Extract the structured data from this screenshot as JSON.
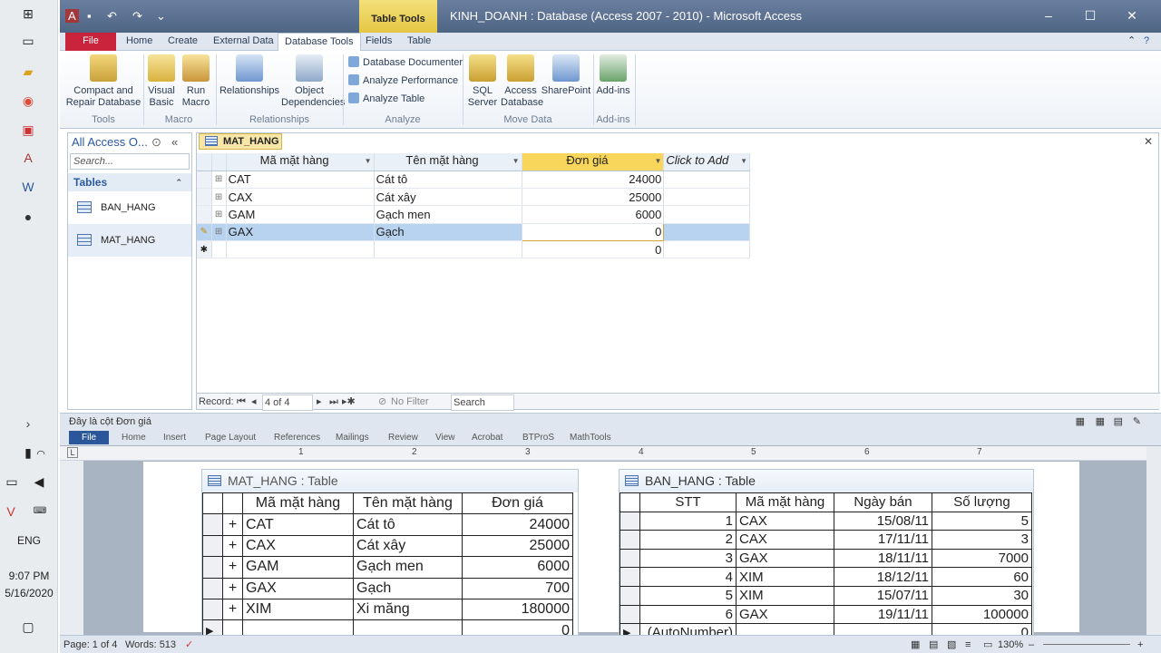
{
  "taskbar": {
    "language": "ENG",
    "time": "9:07 PM",
    "date": "5/16/2020"
  },
  "access": {
    "window_title": "KINH_DOANH : Database (Access 2007 - 2010)  -  Microsoft Access",
    "context_tab": "Table Tools",
    "ribbon_tabs": [
      {
        "label": "File"
      },
      {
        "label": "Home"
      },
      {
        "label": "Create"
      },
      {
        "label": "External Data"
      },
      {
        "label": "Database Tools"
      },
      {
        "label": "Fields"
      },
      {
        "label": "Table"
      }
    ],
    "ribbon": {
      "compact_repair": "Compact and Repair Database",
      "visual_basic": "Visual Basic",
      "run_macro": "Run Macro",
      "relationships": "Relationships",
      "object_dependencies": "Object Dependencies",
      "database_documenter": "Database Documenter",
      "analyze_performance": "Analyze Performance",
      "analyze_table": "Analyze Table",
      "sql_server": "SQL Server",
      "access_database": "Access Database",
      "sharepoint": "SharePoint",
      "add_ins": "Add-ins",
      "groups": {
        "tools": "Tools",
        "macro": "Macro",
        "relationships": "Relationships",
        "analyze": "Analyze",
        "move_data": "Move Data",
        "add_ins": "Add-ins"
      }
    },
    "nav_pane": {
      "header": "All Access O...",
      "search_placeholder": "Search...",
      "section": "Tables",
      "items": [
        "BAN_HANG",
        "MAT_HANG"
      ]
    },
    "datasheet": {
      "tab": "MAT_HANG",
      "columns": [
        "Mã mặt hàng",
        "Tên mặt hàng",
        "Đơn giá",
        "Click to Add"
      ],
      "rows": [
        {
          "ma": "CAT",
          "ten": "Cát tô",
          "gia": "24000"
        },
        {
          "ma": "CAX",
          "ten": "Cát xây",
          "gia": "25000"
        },
        {
          "ma": "GAM",
          "ten": "Gạch men",
          "gia": "6000"
        },
        {
          "ma": "GAX",
          "ten": "Gạch",
          "gia": "0"
        }
      ],
      "new_row_default": "0",
      "record_label": "Record:",
      "record_position": "4 of 4",
      "no_filter": "No Filter",
      "search": "Search"
    },
    "status": "Đây là cột Đơn giá"
  },
  "word": {
    "tabs": [
      "File",
      "Home",
      "Insert",
      "Page Layout",
      "References",
      "Mailings",
      "Review",
      "View",
      "Acrobat",
      "BTProS",
      "MathTools"
    ],
    "ruler_ticks": [
      "1",
      "2",
      "3",
      "4",
      "5",
      "6",
      "7"
    ],
    "mat_hang_snapshot": {
      "title": "MAT_HANG : Table",
      "columns": [
        "Mã mặt hàng",
        "Tên mặt hàng",
        "Đơn giá"
      ],
      "rows": [
        {
          "ma": "CAT",
          "ten": "Cát tô",
          "gia": "24000"
        },
        {
          "ma": "CAX",
          "ten": "Cát xây",
          "gia": "25000"
        },
        {
          "ma": "GAM",
          "ten": "Gạch men",
          "gia": "6000"
        },
        {
          "ma": "GAX",
          "ten": "Gạch",
          "gia": "700"
        },
        {
          "ma": "XIM",
          "ten": "Xi măng",
          "gia": "180000"
        }
      ],
      "new_row_default": "0"
    },
    "ban_hang_snapshot": {
      "title": "BAN_HANG : Table",
      "columns": [
        "STT",
        "Mã mặt hàng",
        "Ngày bán",
        "Số lượng"
      ],
      "rows": [
        {
          "stt": "1",
          "ma": "CAX",
          "ngay": "15/08/11",
          "sl": "5"
        },
        {
          "stt": "2",
          "ma": "CAX",
          "ngay": "17/11/11",
          "sl": "3"
        },
        {
          "stt": "3",
          "ma": "GAX",
          "ngay": "18/11/11",
          "sl": "7000"
        },
        {
          "stt": "4",
          "ma": "XIM",
          "ngay": "18/12/11",
          "sl": "60"
        },
        {
          "stt": "5",
          "ma": "XIM",
          "ngay": "15/07/11",
          "sl": "30"
        },
        {
          "stt": "6",
          "ma": "GAX",
          "ngay": "19/11/11",
          "sl": "100000"
        }
      ],
      "new_row_label": "(AutoNumber)",
      "new_row_default": "0"
    },
    "status": {
      "page": "Page: 1 of 4",
      "words": "Words: 513",
      "zoom": "130%"
    }
  }
}
